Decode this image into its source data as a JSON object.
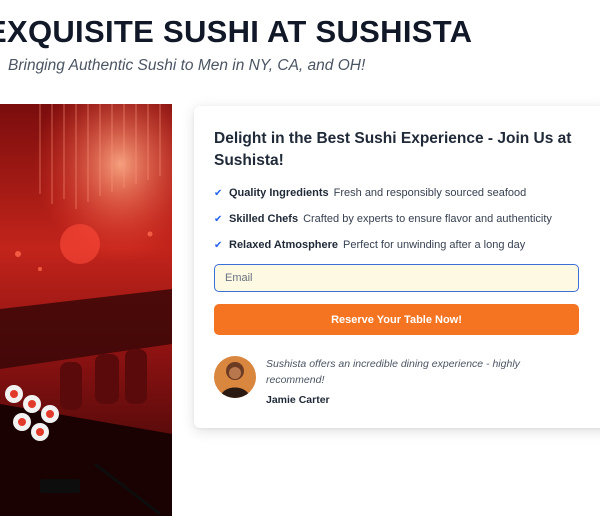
{
  "hero": {
    "title": "EXQUISITE SUSHI AT SUSHISTA",
    "subtitle": "Bringing Authentic Sushi to Men in NY, CA, and OH!"
  },
  "card": {
    "heading": "Delight in the Best Sushi Experience - Join Us at Sushista!",
    "features": [
      {
        "title": "Quality Ingredients",
        "description": "Fresh and responsibly sourced seafood",
        "icon": "checkmark-icon"
      },
      {
        "title": "Skilled Chefs",
        "description": "Crafted by experts to ensure flavor and authenticity",
        "icon": "checkmark-icon"
      },
      {
        "title": "Relaxed Atmosphere",
        "description": "Perfect for unwinding after a long day",
        "icon": "checkmark-icon"
      }
    ],
    "email": {
      "placeholder": "Email",
      "value": ""
    },
    "cta_label": "Reserve Your Table Now!",
    "testimonial": {
      "quote": "Sushista offers an incredible dining experience - highly recommend!",
      "author": "Jamie Carter"
    }
  },
  "colors": {
    "accent": "#f47422",
    "check": "#2563eb",
    "input_border": "#3b6fd8",
    "input_bg": "#fdf9e3"
  }
}
